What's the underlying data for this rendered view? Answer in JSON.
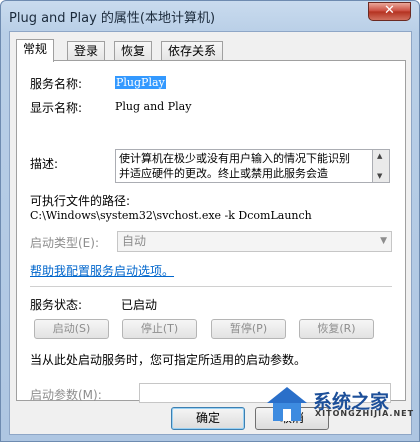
{
  "window": {
    "title": "Plug and Play 的属性(本地计算机)",
    "close_glyph": "✕"
  },
  "tabs": [
    {
      "label": "常规",
      "active": true
    },
    {
      "label": "登录",
      "active": false
    },
    {
      "label": "恢复",
      "active": false
    },
    {
      "label": "依存关系",
      "active": false
    }
  ],
  "general": {
    "service_name_label": "服务名称:",
    "service_name_value": "PlugPlay",
    "display_name_label": "显示名称:",
    "display_name_value": "Plug and Play",
    "description_label": "描述:",
    "description_value": "使计算机在极少或没有用户输入的情况下能识别并适应硬件的更改。终止或禁用此服务会造",
    "exe_path_label": "可执行文件的路径:",
    "exe_path_value": "C:\\Windows\\system32\\svchost.exe -k DcomLaunch",
    "startup_type_label": "启动类型(E):",
    "startup_type_value": "自动",
    "help_link": "帮助我配置服务启动选项。",
    "status_label": "服务状态:",
    "status_value": "已启动",
    "buttons": {
      "start": "启动(S)",
      "stop": "停止(T)",
      "pause": "暂停(P)",
      "resume": "恢复(R)"
    },
    "hint": "当从此处启动服务时，您可指定所适用的启动参数。",
    "start_params_label": "启动参数(M):",
    "start_params_value": ""
  },
  "footer": {
    "ok": "确定",
    "cancel": "取消"
  },
  "watermark": {
    "text": "系统之家",
    "sub": "XITONGZHIJIA.NET"
  }
}
